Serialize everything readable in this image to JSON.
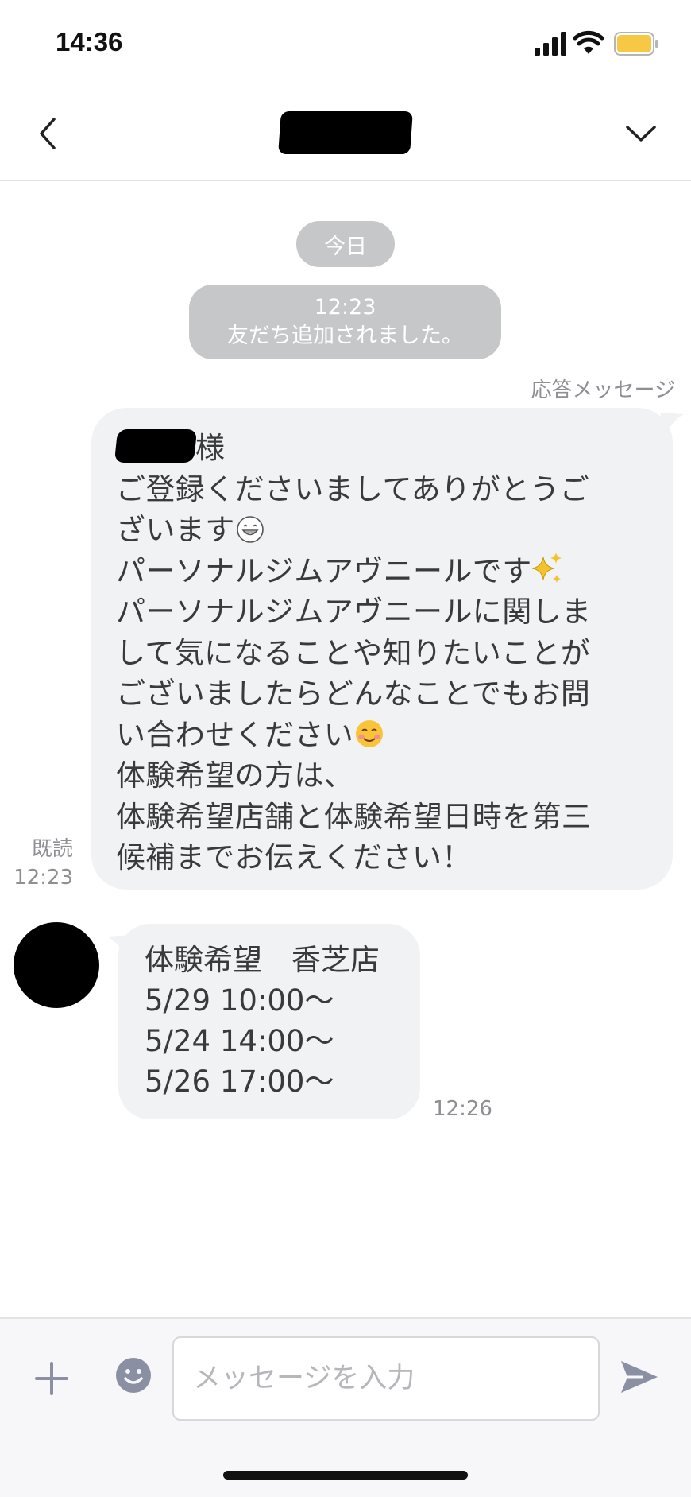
{
  "status_bar": {
    "time": "14:36"
  },
  "chat": {
    "date_label": "今日",
    "system_message": {
      "time": "12:23",
      "text": "友だち追加されました。"
    },
    "auto_reply_label": "応答メッセージ",
    "outgoing": {
      "name_suffix": "様",
      "lines": [
        "ご登録くださいましてありがとうご",
        "ざいます",
        "パーソナルジムアヴニールです",
        "パーソナルジムアヴニールに関しま",
        "して気になることや知りたいことが",
        "ございましたらどんなことでもお問",
        "い合わせください",
        "体験希望の方は、",
        "体験希望店舗と体験希望日時を第三",
        "候補までお伝えください！"
      ],
      "read_label": "既読",
      "time": "12:23"
    },
    "incoming": {
      "lines": [
        "体験希望　香芝店",
        "5/29 10:00～",
        "5/24 14:00～",
        "5/26 17:00～"
      ],
      "time": "12:26"
    }
  },
  "input": {
    "placeholder": "メッセージを入力"
  },
  "colors": {
    "bubble": "#f1f2f4",
    "system_pill": "#c6c7c9",
    "meta_text": "#8e8e93",
    "icon": "#8a8fa3"
  }
}
